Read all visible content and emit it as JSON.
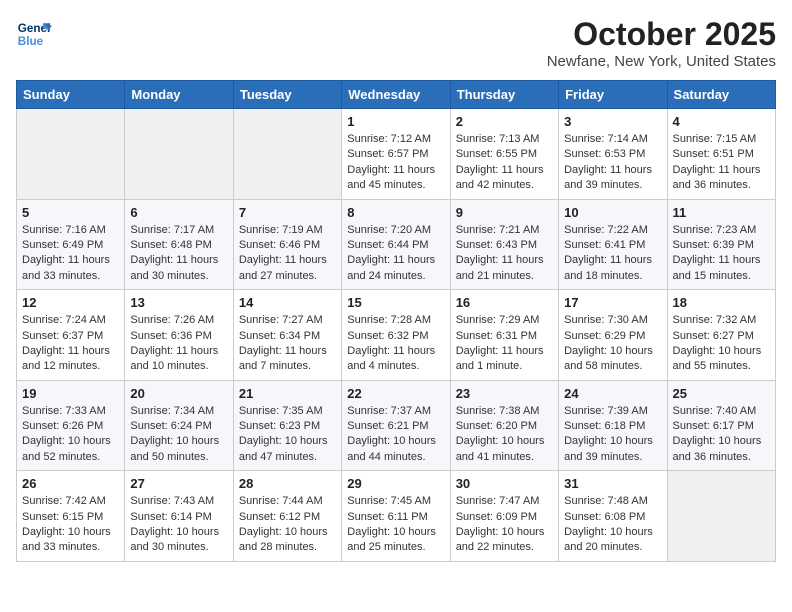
{
  "header": {
    "logo_line1": "General",
    "logo_line2": "Blue",
    "month_title": "October 2025",
    "location": "Newfane, New York, United States"
  },
  "days_of_week": [
    "Sunday",
    "Monday",
    "Tuesday",
    "Wednesday",
    "Thursday",
    "Friday",
    "Saturday"
  ],
  "weeks": [
    [
      {
        "day": "",
        "info": ""
      },
      {
        "day": "",
        "info": ""
      },
      {
        "day": "",
        "info": ""
      },
      {
        "day": "1",
        "info": "Sunrise: 7:12 AM\nSunset: 6:57 PM\nDaylight: 11 hours\nand 45 minutes."
      },
      {
        "day": "2",
        "info": "Sunrise: 7:13 AM\nSunset: 6:55 PM\nDaylight: 11 hours\nand 42 minutes."
      },
      {
        "day": "3",
        "info": "Sunrise: 7:14 AM\nSunset: 6:53 PM\nDaylight: 11 hours\nand 39 minutes."
      },
      {
        "day": "4",
        "info": "Sunrise: 7:15 AM\nSunset: 6:51 PM\nDaylight: 11 hours\nand 36 minutes."
      }
    ],
    [
      {
        "day": "5",
        "info": "Sunrise: 7:16 AM\nSunset: 6:49 PM\nDaylight: 11 hours\nand 33 minutes."
      },
      {
        "day": "6",
        "info": "Sunrise: 7:17 AM\nSunset: 6:48 PM\nDaylight: 11 hours\nand 30 minutes."
      },
      {
        "day": "7",
        "info": "Sunrise: 7:19 AM\nSunset: 6:46 PM\nDaylight: 11 hours\nand 27 minutes."
      },
      {
        "day": "8",
        "info": "Sunrise: 7:20 AM\nSunset: 6:44 PM\nDaylight: 11 hours\nand 24 minutes."
      },
      {
        "day": "9",
        "info": "Sunrise: 7:21 AM\nSunset: 6:43 PM\nDaylight: 11 hours\nand 21 minutes."
      },
      {
        "day": "10",
        "info": "Sunrise: 7:22 AM\nSunset: 6:41 PM\nDaylight: 11 hours\nand 18 minutes."
      },
      {
        "day": "11",
        "info": "Sunrise: 7:23 AM\nSunset: 6:39 PM\nDaylight: 11 hours\nand 15 minutes."
      }
    ],
    [
      {
        "day": "12",
        "info": "Sunrise: 7:24 AM\nSunset: 6:37 PM\nDaylight: 11 hours\nand 12 minutes."
      },
      {
        "day": "13",
        "info": "Sunrise: 7:26 AM\nSunset: 6:36 PM\nDaylight: 11 hours\nand 10 minutes."
      },
      {
        "day": "14",
        "info": "Sunrise: 7:27 AM\nSunset: 6:34 PM\nDaylight: 11 hours\nand 7 minutes."
      },
      {
        "day": "15",
        "info": "Sunrise: 7:28 AM\nSunset: 6:32 PM\nDaylight: 11 hours\nand 4 minutes."
      },
      {
        "day": "16",
        "info": "Sunrise: 7:29 AM\nSunset: 6:31 PM\nDaylight: 11 hours\nand 1 minute."
      },
      {
        "day": "17",
        "info": "Sunrise: 7:30 AM\nSunset: 6:29 PM\nDaylight: 10 hours\nand 58 minutes."
      },
      {
        "day": "18",
        "info": "Sunrise: 7:32 AM\nSunset: 6:27 PM\nDaylight: 10 hours\nand 55 minutes."
      }
    ],
    [
      {
        "day": "19",
        "info": "Sunrise: 7:33 AM\nSunset: 6:26 PM\nDaylight: 10 hours\nand 52 minutes."
      },
      {
        "day": "20",
        "info": "Sunrise: 7:34 AM\nSunset: 6:24 PM\nDaylight: 10 hours\nand 50 minutes."
      },
      {
        "day": "21",
        "info": "Sunrise: 7:35 AM\nSunset: 6:23 PM\nDaylight: 10 hours\nand 47 minutes."
      },
      {
        "day": "22",
        "info": "Sunrise: 7:37 AM\nSunset: 6:21 PM\nDaylight: 10 hours\nand 44 minutes."
      },
      {
        "day": "23",
        "info": "Sunrise: 7:38 AM\nSunset: 6:20 PM\nDaylight: 10 hours\nand 41 minutes."
      },
      {
        "day": "24",
        "info": "Sunrise: 7:39 AM\nSunset: 6:18 PM\nDaylight: 10 hours\nand 39 minutes."
      },
      {
        "day": "25",
        "info": "Sunrise: 7:40 AM\nSunset: 6:17 PM\nDaylight: 10 hours\nand 36 minutes."
      }
    ],
    [
      {
        "day": "26",
        "info": "Sunrise: 7:42 AM\nSunset: 6:15 PM\nDaylight: 10 hours\nand 33 minutes."
      },
      {
        "day": "27",
        "info": "Sunrise: 7:43 AM\nSunset: 6:14 PM\nDaylight: 10 hours\nand 30 minutes."
      },
      {
        "day": "28",
        "info": "Sunrise: 7:44 AM\nSunset: 6:12 PM\nDaylight: 10 hours\nand 28 minutes."
      },
      {
        "day": "29",
        "info": "Sunrise: 7:45 AM\nSunset: 6:11 PM\nDaylight: 10 hours\nand 25 minutes."
      },
      {
        "day": "30",
        "info": "Sunrise: 7:47 AM\nSunset: 6:09 PM\nDaylight: 10 hours\nand 22 minutes."
      },
      {
        "day": "31",
        "info": "Sunrise: 7:48 AM\nSunset: 6:08 PM\nDaylight: 10 hours\nand 20 minutes."
      },
      {
        "day": "",
        "info": ""
      }
    ]
  ]
}
